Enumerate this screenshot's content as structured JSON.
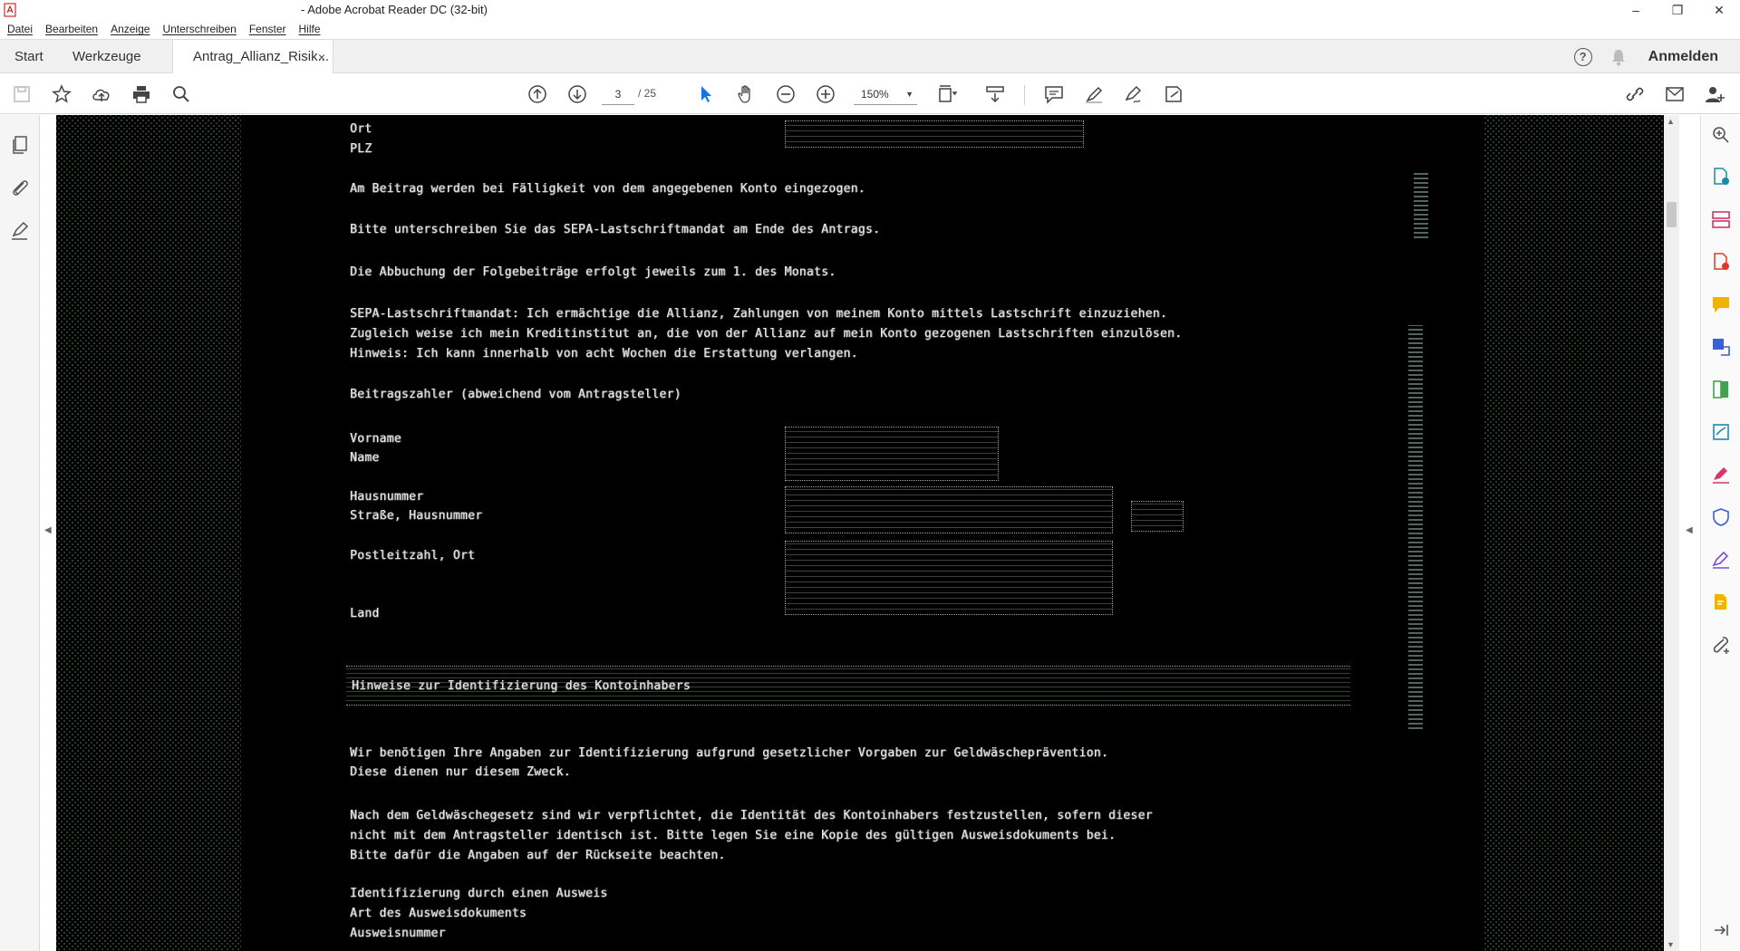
{
  "window": {
    "title": "- Adobe Acrobat Reader DC (32-bit)",
    "minimize": "–",
    "maximize": "❐",
    "close": "✕"
  },
  "menu": [
    "Datei",
    "Bearbeiten",
    "Anzeige",
    "Unterschreiben",
    "Fenster",
    "Hilfe"
  ],
  "tabs": {
    "start": "Start",
    "tools": "Werkzeuge",
    "document": "Antrag_Allianz_Risik...",
    "close": "×"
  },
  "header": {
    "help": "?",
    "signin": "Anmelden"
  },
  "toolbar": {
    "page_current": "3",
    "page_total": "/ 25",
    "zoom": "150%",
    "accent_color": "#1473e6"
  },
  "document": {
    "lines": [
      "Ort",
      "PLZ",
      "Am Beitrag werden bei Fälligkeit von dem angegebenen Konto eingezogen.",
      "Bitte unterschreiben Sie das SEPA-Lastschriftmandat am Ende des Antrags.",
      "Die Abbuchung der Folgebeiträge erfolgt jeweils zum 1. des Monats.",
      "SEPA-Lastschriftmandat: Ich ermächtige die Allianz, Zahlungen von meinem Konto mittels Lastschrift einzuziehen.",
      "Zugleich weise ich mein Kreditinstitut an, die von der Allianz auf mein Konto gezogenen Lastschriften einzulösen.",
      "Hinweis: Ich kann innerhalb von acht Wochen die Erstattung verlangen.",
      "Beitragszahler (abweichend vom Antragsteller)",
      "Vorname",
      "Name",
      "Hausnummer",
      "Straße, Hausnummer",
      "Postleitzahl, Ort",
      "Land",
      "Hinweise zur Identifizierung des Kontoinhabers",
      "Wir benötigen Ihre Angaben zur Identifizierung aufgrund gesetzlicher Vorgaben zur Geldwäscheprävention.",
      "Diese dienen nur diesem Zweck.",
      "Nach dem Geldwäschegesetz sind wir verpflichtet, die Identität des Kontoinhabers festzustellen, sofern dieser",
      "nicht mit dem Antragsteller identisch ist. Bitte legen Sie eine Kopie des gültigen Ausweisdokuments bei.",
      "Bitte dafür die Angaben auf der Rückseite beachten.",
      "Identifizierung durch einen Ausweis",
      "Art des Ausweisdokuments",
      "Ausweisnummer"
    ]
  }
}
